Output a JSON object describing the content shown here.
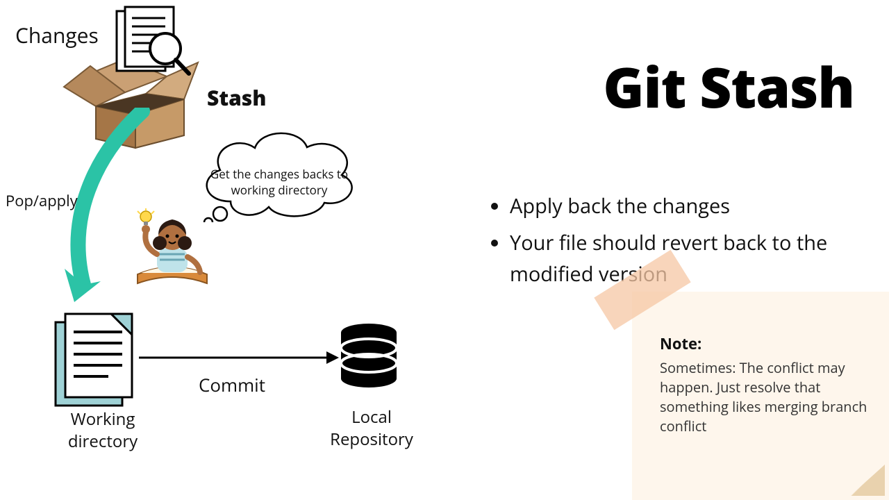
{
  "title": "Git Stash",
  "labels": {
    "changes": "Changes",
    "stash": "Stash",
    "pop_apply": "Pop/apply",
    "commit": "Commit",
    "working_directory": "Working directory",
    "local_repository": "Local Repository"
  },
  "thought_bubble": "Get the changes backs to working directory",
  "bullets": [
    "Apply back the changes",
    "Your file should revert back to the modified version"
  ],
  "note": {
    "title": "Note:",
    "body": "Sometimes: The conflict may happen.\n Just resolve that something likes merging branch conflict"
  },
  "colors": {
    "arrow_teal": "#2bc3a6",
    "note_bg": "#fef6ec",
    "tape": "#f6c7a4",
    "doc_teal": "#9fd2d6"
  },
  "icons": {
    "box": "open-cardboard-box",
    "doc_magnifier": "document-with-magnifier",
    "working_doc": "file-icon",
    "database": "database-cylinder",
    "girl": "girl-with-idea-reading-book",
    "curved_arrow": "curved-arrow-down",
    "straight_arrow": "arrow-right"
  }
}
